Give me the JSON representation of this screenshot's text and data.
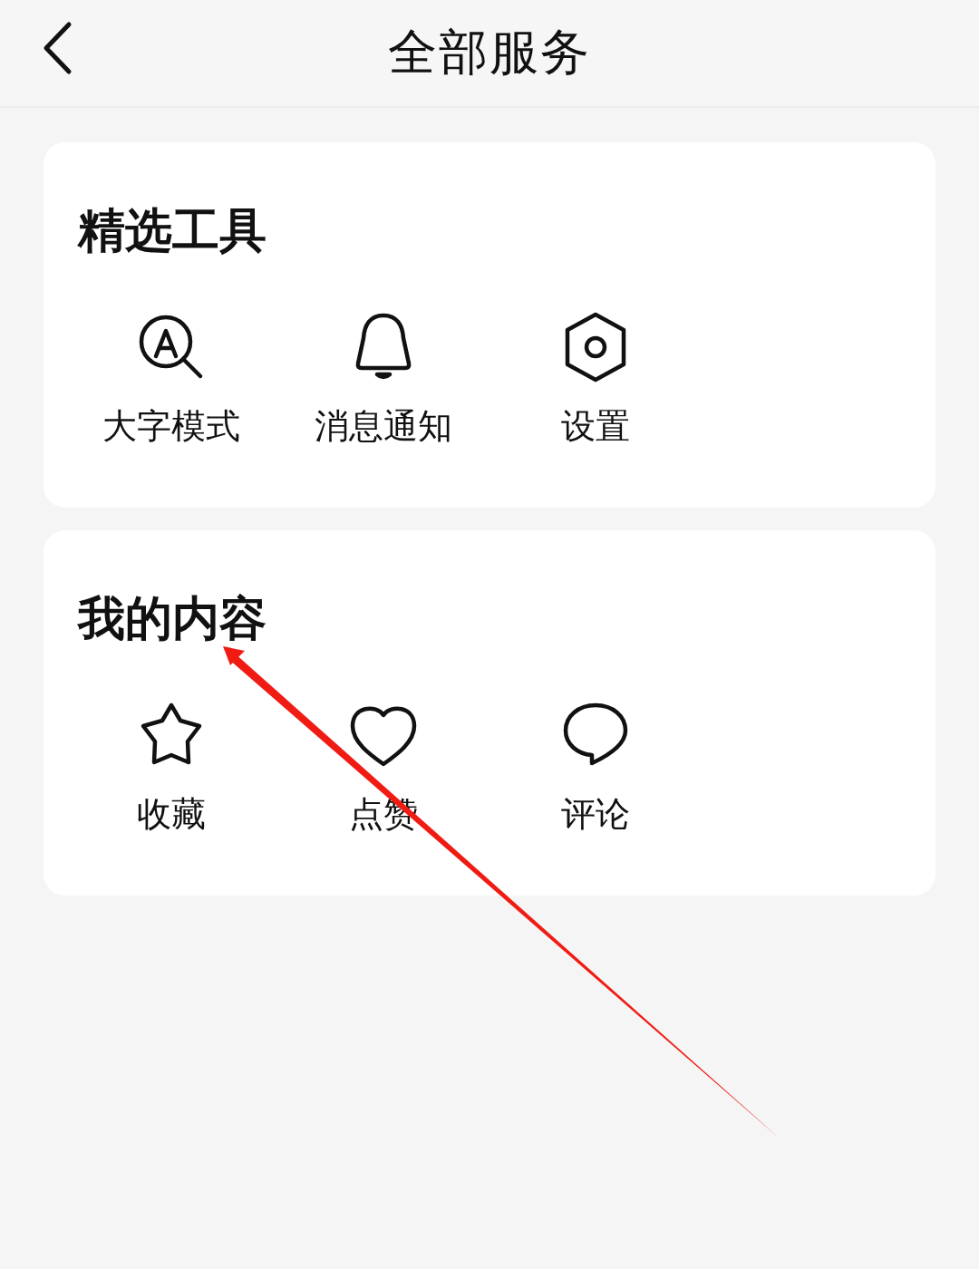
{
  "header": {
    "title": "全部服务"
  },
  "sections": [
    {
      "title": "精选工具",
      "items": [
        {
          "label": "大字模式"
        },
        {
          "label": "消息通知"
        },
        {
          "label": "设置"
        }
      ]
    },
    {
      "title": "我的内容",
      "items": [
        {
          "label": "收藏"
        },
        {
          "label": "点赞"
        },
        {
          "label": "评论"
        }
      ]
    }
  ]
}
